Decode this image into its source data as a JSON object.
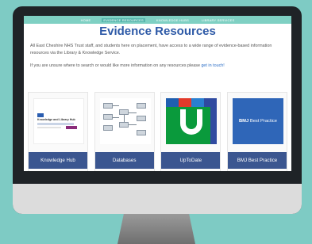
{
  "nav": {
    "items": [
      "HOME",
      "EVIDENCE RESOURCES",
      "KNOWLEDGE HUBS",
      "LIBRARY SERVICES"
    ],
    "active_index": 1
  },
  "page": {
    "title": "Evidence Resources",
    "intro": "All East Cheshire NHS Trust staff, and students here on placement, have access to a wide range of evidence-based information resources via the Library & Knowledge Service.",
    "hint_text": "If you are unsure where to search or would like more information on any resources please ",
    "hint_link": "get in touch!"
  },
  "cards": [
    {
      "label": "Knowledge Hub",
      "thumb_title": "Knowledge and Library Hub"
    },
    {
      "label": "Databases"
    },
    {
      "label": "UpToDate"
    },
    {
      "label": "BMJ Best Practice",
      "thumb_brand": "BMJ",
      "thumb_text": "Best Practice"
    }
  ],
  "colors": {
    "background": "#7ecbc4",
    "nav": "#7fd0c3",
    "title": "#2e5aa7",
    "card_label_bg": "#3b5690",
    "uptodate_green": "#0a9a3c",
    "bmj_blue": "#2f66b8"
  }
}
